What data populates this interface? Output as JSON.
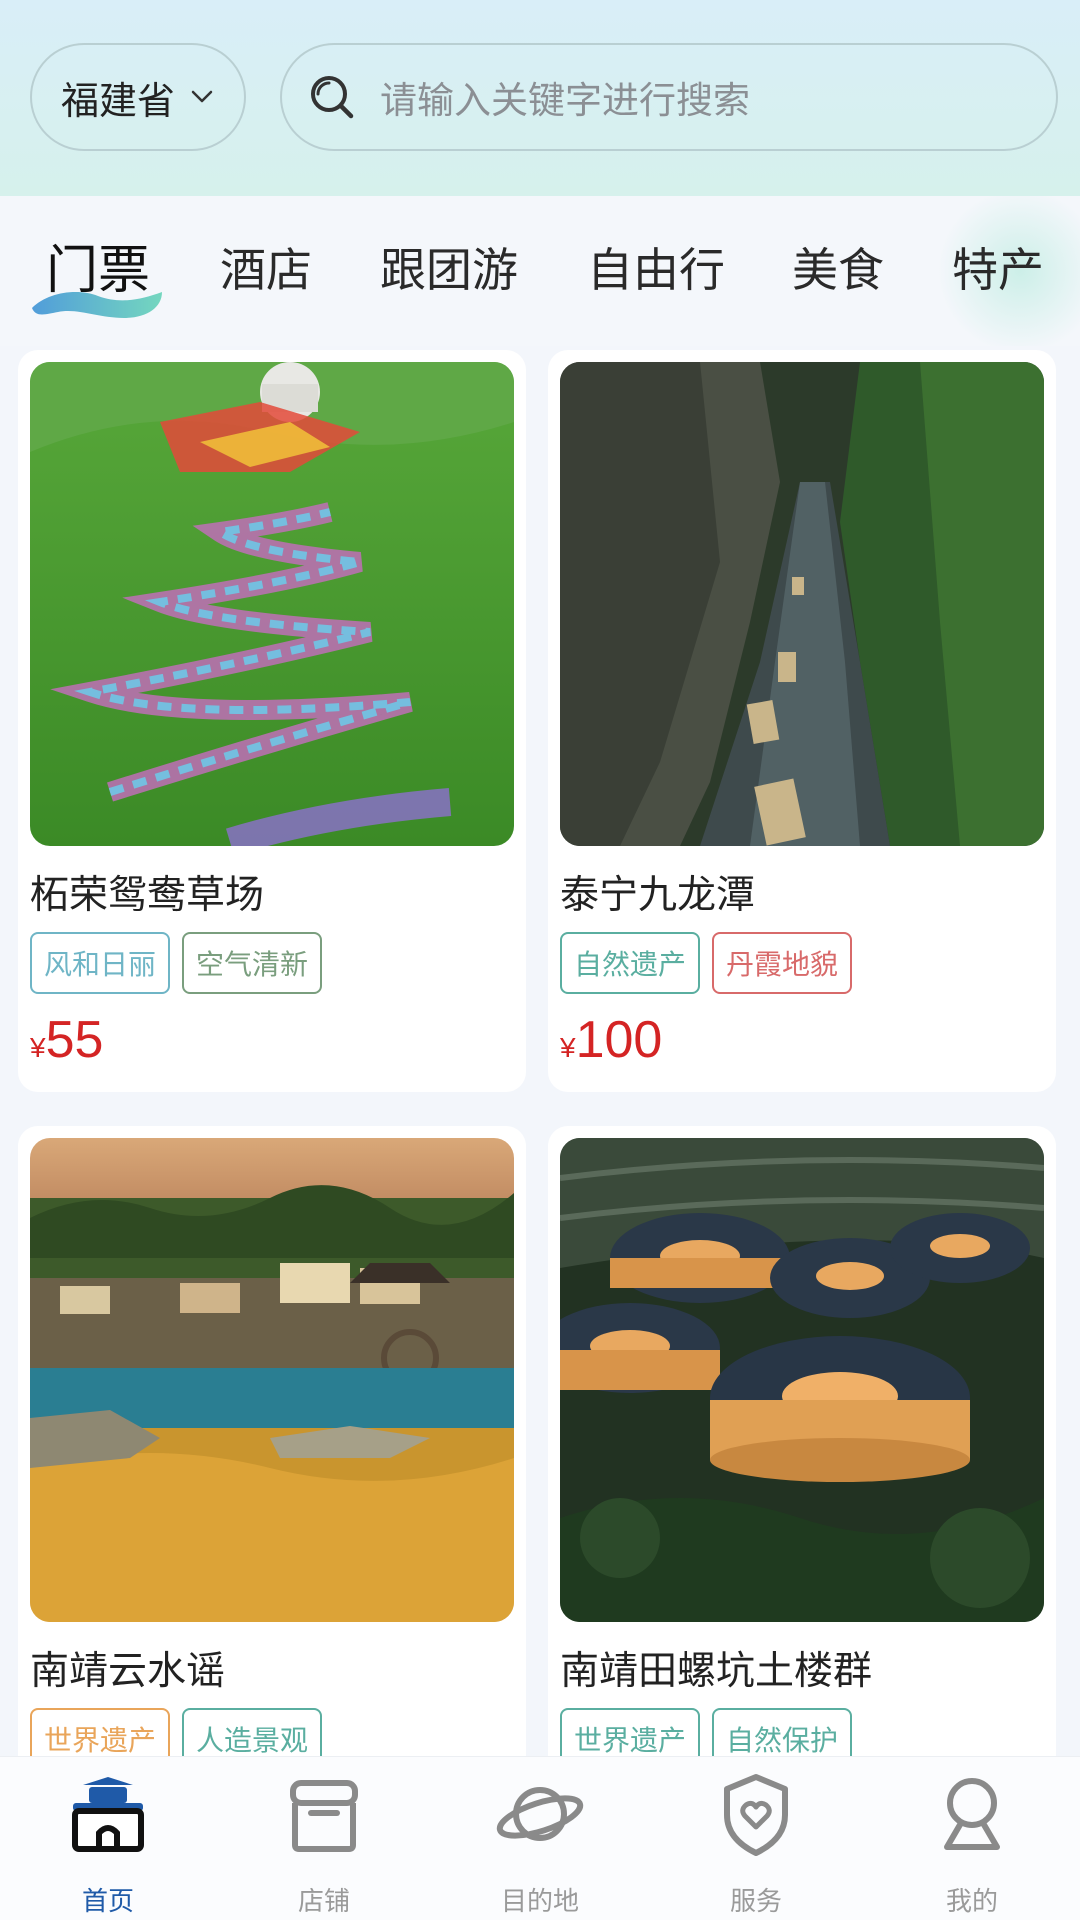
{
  "header": {
    "province": "福建省",
    "search_placeholder": "请输入关键字进行搜索"
  },
  "tabs": [
    {
      "label": "门票",
      "active": true
    },
    {
      "label": "酒店"
    },
    {
      "label": "跟团游"
    },
    {
      "label": "自由行"
    },
    {
      "label": "美食"
    },
    {
      "label": "特产"
    }
  ],
  "cards": [
    {
      "title": "柘荣鸳鸯草场",
      "tags": [
        "风和日丽",
        "空气清新"
      ],
      "currency": "¥",
      "price": "55"
    },
    {
      "title": "泰宁九龙潭",
      "tags": [
        "自然遗产",
        "丹霞地貌"
      ],
      "currency": "¥",
      "price": "100"
    },
    {
      "title": "南靖云水谣",
      "tags": [
        "世界遗产",
        "人造景观"
      ]
    },
    {
      "title": "南靖田螺坑土楼群",
      "tags": [
        "世界遗产",
        "自然保护"
      ]
    }
  ],
  "colors": {
    "accent": "#1f5aa8",
    "price": "#d42424",
    "tag_blue": "#6fb5c6",
    "tag_green": "#7a9e7e",
    "tag_teal": "#5aaea0",
    "tag_red": "#d86a6a",
    "tag_orange": "#e9a55a"
  },
  "bottom_nav": [
    {
      "label": "首页",
      "icon": "home-icon",
      "active": true
    },
    {
      "label": "店铺",
      "icon": "shop-icon"
    },
    {
      "label": "目的地",
      "icon": "planet-icon"
    },
    {
      "label": "服务",
      "icon": "shield-heart-icon"
    },
    {
      "label": "我的",
      "icon": "user-icon"
    }
  ]
}
